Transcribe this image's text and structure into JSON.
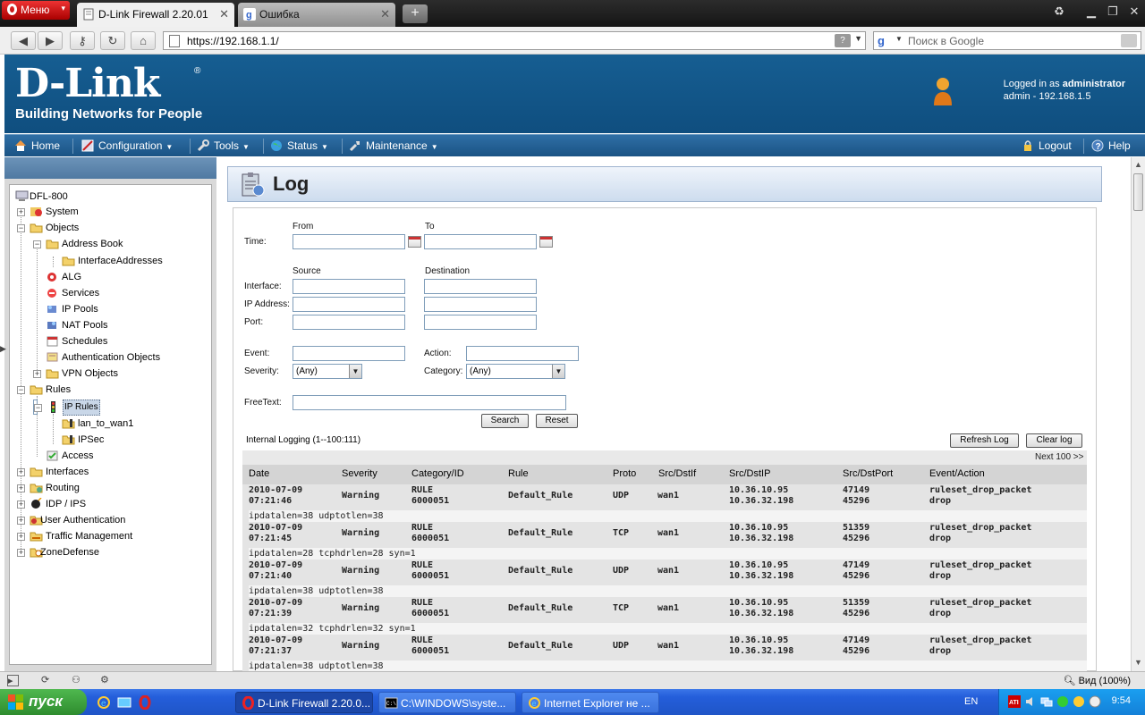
{
  "browser": {
    "menu_label": "Меню",
    "tabs": [
      {
        "title": "D-Link Firewall 2.20.01"
      },
      {
        "title": "Ошибка"
      }
    ],
    "address": "https://192.168.1.1/",
    "search_placeholder": "Поиск в Google",
    "status_zoom": "Вид (100%)"
  },
  "header": {
    "brand": "D-Link",
    "tagline": "Building Networks for People",
    "logged_in_prefix": "Logged in as",
    "logged_in_user": "administrator",
    "session": "admin - 192.168.1.5"
  },
  "menu": {
    "home": "Home",
    "configuration": "Configuration",
    "tools": "Tools",
    "status": "Status",
    "maintenance": "Maintenance",
    "logout": "Logout",
    "help": "Help"
  },
  "tree": {
    "root": "DFL-800",
    "system": "System",
    "objects": "Objects",
    "address_book": "Address Book",
    "interface_addresses": "InterfaceAddresses",
    "alg": "ALG",
    "services": "Services",
    "ip_pools": "IP Pools",
    "nat_pools": "NAT Pools",
    "schedules": "Schedules",
    "auth_objects": "Authentication Objects",
    "vpn_objects": "VPN Objects",
    "rules": "Rules",
    "ip_rules": "IP Rules",
    "lan_to_wan1": "lan_to_wan1",
    "ipsec": "IPSec",
    "access": "Access",
    "interfaces": "Interfaces",
    "routing": "Routing",
    "idp_ips": "IDP / IPS",
    "user_auth": "User Authentication",
    "traffic_mgmt": "Traffic Management",
    "zonedefense": "ZoneDefense"
  },
  "page": {
    "title": "Log"
  },
  "form": {
    "from": "From",
    "to": "To",
    "time": "Time:",
    "source": "Source",
    "destination": "Destination",
    "interface": "Interface:",
    "ip_address": "IP Address:",
    "port": "Port:",
    "event": "Event:",
    "action": "Action:",
    "severity": "Severity:",
    "severity_value": "(Any)",
    "category": "Category:",
    "category_value": "(Any)",
    "freetext": "FreeText:",
    "search_btn": "Search",
    "reset_btn": "Reset"
  },
  "log": {
    "summary": "Internal Logging (1--100:111)",
    "refresh_btn": "Refresh Log",
    "clear_btn": "Clear log",
    "next": "Next 100 >>",
    "headers": {
      "date": "Date",
      "severity": "Severity",
      "category": "Category/ID",
      "rule": "Rule",
      "proto": "Proto",
      "srcdstif": "Src/DstIf",
      "srcdstip": "Src/DstIP",
      "srcdstport": "Src/DstPort",
      "event": "Event/Action"
    },
    "rows": [
      {
        "date": "2010-07-09",
        "time": "07:21:46",
        "severity": "Warning",
        "cat": "RULE",
        "id": "6000051",
        "rule": "Default_Rule",
        "proto": "UDP",
        "iface": "wan1",
        "src_ip": "10.36.10.95",
        "dst_ip": "10.36.32.198",
        "src_port": "47149",
        "dst_port": "45296",
        "event": "ruleset_drop_packet",
        "action": "drop",
        "extra": "ipdatalen=38 udptotlen=38"
      },
      {
        "date": "2010-07-09",
        "time": "07:21:45",
        "severity": "Warning",
        "cat": "RULE",
        "id": "6000051",
        "rule": "Default_Rule",
        "proto": "TCP",
        "iface": "wan1",
        "src_ip": "10.36.10.95",
        "dst_ip": "10.36.32.198",
        "src_port": "51359",
        "dst_port": "45296",
        "event": "ruleset_drop_packet",
        "action": "drop",
        "extra": "ipdatalen=28 tcphdrlen=28 syn=1"
      },
      {
        "date": "2010-07-09",
        "time": "07:21:40",
        "severity": "Warning",
        "cat": "RULE",
        "id": "6000051",
        "rule": "Default_Rule",
        "proto": "UDP",
        "iface": "wan1",
        "src_ip": "10.36.10.95",
        "dst_ip": "10.36.32.198",
        "src_port": "47149",
        "dst_port": "45296",
        "event": "ruleset_drop_packet",
        "action": "drop",
        "extra": "ipdatalen=38 udptotlen=38"
      },
      {
        "date": "2010-07-09",
        "time": "07:21:39",
        "severity": "Warning",
        "cat": "RULE",
        "id": "6000051",
        "rule": "Default_Rule",
        "proto": "TCP",
        "iface": "wan1",
        "src_ip": "10.36.10.95",
        "dst_ip": "10.36.32.198",
        "src_port": "51359",
        "dst_port": "45296",
        "event": "ruleset_drop_packet",
        "action": "drop",
        "extra": "ipdatalen=32 tcphdrlen=32 syn=1"
      },
      {
        "date": "2010-07-09",
        "time": "07:21:37",
        "severity": "Warning",
        "cat": "RULE",
        "id": "6000051",
        "rule": "Default_Rule",
        "proto": "UDP",
        "iface": "wan1",
        "src_ip": "10.36.10.95",
        "dst_ip": "10.36.32.198",
        "src_port": "47149",
        "dst_port": "45296",
        "event": "ruleset_drop_packet",
        "action": "drop",
        "extra": "ipdatalen=38 udptotlen=38"
      }
    ]
  },
  "taskbar": {
    "start": "пуск",
    "tasks": [
      {
        "label": "D-Link Firewall 2.20.0..."
      },
      {
        "label": "C:\\WINDOWS\\syste..."
      },
      {
        "label": "Internet Explorer не ..."
      }
    ],
    "lang": "EN",
    "clock": "9:54"
  },
  "colors": {
    "dlink_blue": "#165e92",
    "menubar_blue": "#2f6fa6",
    "opera_red": "#cc1111",
    "xp_blue": "#245edb",
    "xp_green": "#3a9a3a"
  }
}
